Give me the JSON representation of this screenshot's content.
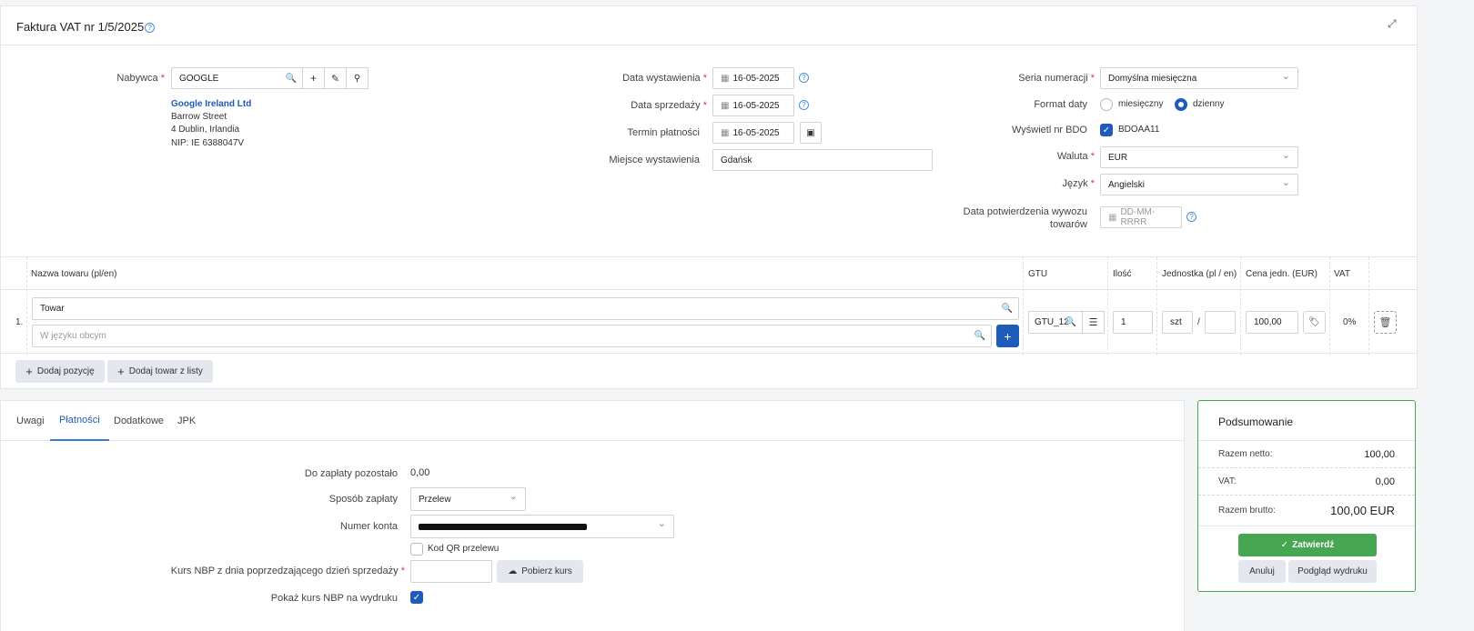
{
  "header": {
    "title": "Faktura VAT nr 1/5/2025",
    "help": "?",
    "expand_icon": "expand-icon"
  },
  "buyer": {
    "label": "Nabywca",
    "value": "GOOGLE",
    "name": "Google Ireland Ltd",
    "address1": "Barrow Street",
    "address2": "4 Dublin, Irlandia",
    "nip": "NIP: IE 6388047V"
  },
  "dates": {
    "issue_label": "Data wystawienia",
    "issue_value": "16-05-2025",
    "sale_label": "Data sprzedaży",
    "sale_value": "16-05-2025",
    "due_label": "Termin płatności",
    "due_value": "16-05-2025",
    "place_label": "Miejsce wystawienia",
    "place_value": "Gdańsk"
  },
  "settings": {
    "series_label": "Seria numeracji",
    "series_value": "Domyślna miesięczna",
    "date_format_label": "Format daty",
    "monthly_label": "miesięczny",
    "daily_label": "dzienny",
    "bdo_label": "Wyświetl nr BDO",
    "bdo_value": "BDOAA11",
    "currency_label": "Waluta",
    "currency_value": "EUR",
    "language_label": "Język",
    "language_value": "Angielski",
    "export_label_1": "Data potwierdzenia wywozu",
    "export_label_2": "towarów",
    "export_placeholder": "DD-MM-RRRR"
  },
  "table": {
    "headers": {
      "name": "Nazwa towaru (pl/en)",
      "gtu": "GTU",
      "qty": "Ilość",
      "unit": "Jednostka (pl / en)",
      "price": "Cena jedn. (EUR)",
      "vat": "VAT"
    },
    "row": {
      "num": "1.",
      "name": "Towar",
      "foreign_placeholder": "W języku obcym",
      "gtu": "GTU_12",
      "qty": "1",
      "unit": "szt",
      "slash": "/",
      "price": "100,00",
      "vat": "0%"
    },
    "add_position": "Dodaj pozycję",
    "add_from_list": "Dodaj towar z listy"
  },
  "tabs": [
    "Uwagi",
    "Płatności",
    "Dodatkowe",
    "JPK"
  ],
  "payments": {
    "remaining_label": "Do zapłaty pozostało",
    "remaining_value": "0,00",
    "method_label": "Sposób zapłaty",
    "method_value": "Przelew",
    "account_label": "Numer konta",
    "qr_label": "Kod QR przelewu",
    "rate_label": "Kurs NBP z dnia poprzedzającego dzień sprzedaży",
    "fetch_rate": "Pobierz kurs",
    "show_rate_label": "Pokaż kurs NBP na wydruku"
  },
  "summary": {
    "title": "Podsumowanie",
    "net_label": "Razem netto:",
    "net_value": "100,00",
    "vat_label": "VAT:",
    "vat_value": "0,00",
    "gross_label": "Razem brutto:",
    "gross_value": "100,00 EUR",
    "confirm": "Zatwierdź",
    "cancel": "Anuluj",
    "preview": "Podgląd wydruku"
  },
  "colors": {
    "primary": "#1f5bb8",
    "success": "#46a651",
    "link": "#1f5bb8"
  }
}
